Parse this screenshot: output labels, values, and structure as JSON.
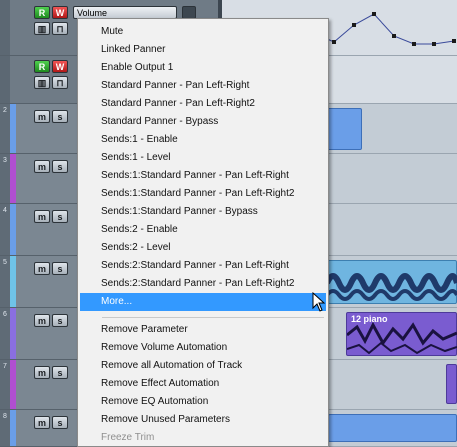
{
  "track_header": {
    "r_label": "R",
    "w_label": "W",
    "m_label": "m",
    "s_label": "s",
    "automation_param": "Volume"
  },
  "track_numbers": [
    "2",
    "3",
    "4",
    "5",
    "6",
    "7",
    "8"
  ],
  "colors": {
    "menu_highlight": "#3399ff",
    "event_blue": "#6a9ee8",
    "event_purple": "#7a5cd0",
    "audio_wave": "#2a2a5a",
    "read_button": "#2ea82e",
    "write_button": "#d42a2a"
  },
  "events": {
    "piano_label": "12 piano"
  },
  "context_menu": {
    "items": [
      {
        "label": "Mute"
      },
      {
        "label": "Linked Panner"
      },
      {
        "label": "Enable Output 1"
      },
      {
        "label": "Standard Panner - Pan Left-Right"
      },
      {
        "label": "Standard Panner - Pan Left-Right2"
      },
      {
        "label": "Standard Panner - Bypass"
      },
      {
        "label": "Sends:1 - Enable"
      },
      {
        "label": "Sends:1 - Level"
      },
      {
        "label": "Sends:1:Standard Panner - Pan Left-Right"
      },
      {
        "label": "Sends:1:Standard Panner - Pan Left-Right2"
      },
      {
        "label": "Sends:1:Standard Panner - Bypass"
      },
      {
        "label": "Sends:2 - Enable"
      },
      {
        "label": "Sends:2 - Level"
      },
      {
        "label": "Sends:2:Standard Panner - Pan Left-Right"
      },
      {
        "label": "Sends:2:Standard Panner - Pan Left-Right2"
      },
      {
        "label": "More..."
      },
      {
        "label": "Remove Parameter"
      },
      {
        "label": "Remove Volume Automation"
      },
      {
        "label": "Remove all Automation of Track"
      },
      {
        "label": "Remove Effect Automation"
      },
      {
        "label": "Remove EQ Automation"
      },
      {
        "label": "Remove Unused Parameters"
      },
      {
        "label": "Freeze Trim"
      }
    ],
    "highlighted_label": "More...",
    "disabled_label": "Freeze Trim"
  }
}
